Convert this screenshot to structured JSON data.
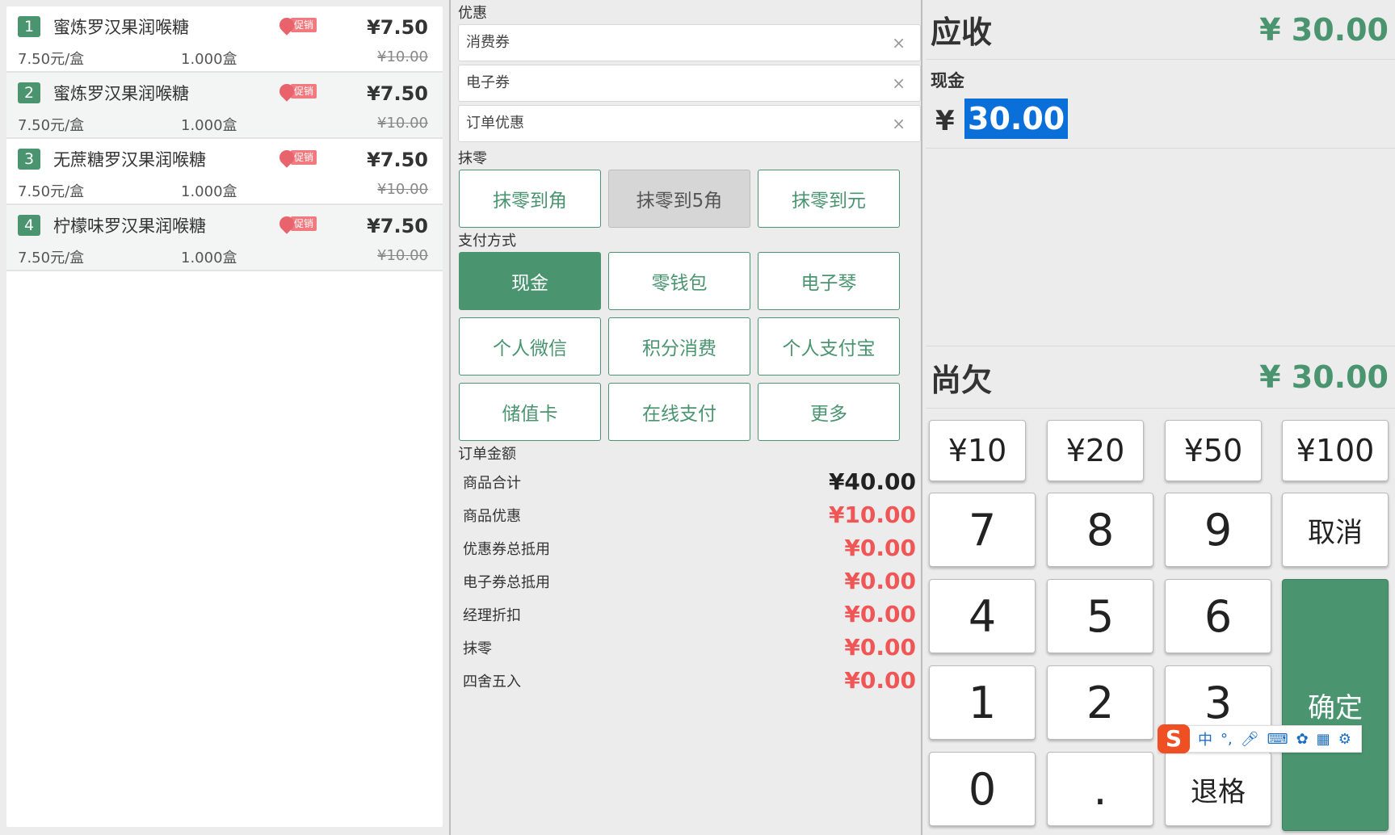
{
  "items": [
    {
      "no": "1",
      "name": "蜜炼罗汉果润喉糖",
      "promo": "促销",
      "price": "¥7.50",
      "unit_price": "7.50元/盒",
      "qty": "1.000盒",
      "orig_price": "¥10.00"
    },
    {
      "no": "2",
      "name": "蜜炼罗汉果润喉糖",
      "promo": "促销",
      "price": "¥7.50",
      "unit_price": "7.50元/盒",
      "qty": "1.000盒",
      "orig_price": "¥10.00"
    },
    {
      "no": "3",
      "name": "无蔗糖罗汉果润喉糖",
      "promo": "促销",
      "price": "¥7.50",
      "unit_price": "7.50元/盒",
      "qty": "1.000盒",
      "orig_price": "¥10.00"
    },
    {
      "no": "4",
      "name": "柠檬味罗汉果润喉糖",
      "promo": "促销",
      "price": "¥7.50",
      "unit_price": "7.50元/盒",
      "qty": "1.000盒",
      "orig_price": "¥10.00"
    }
  ],
  "discount": {
    "title": "优惠",
    "fields": [
      {
        "label": "消费券"
      },
      {
        "label": "电子券"
      },
      {
        "label": "订单优惠"
      }
    ],
    "clear_glyph": "×"
  },
  "rounding": {
    "title": "抹零",
    "options": [
      "抹零到角",
      "抹零到5角",
      "抹零到元"
    ],
    "selected_index": 1
  },
  "payment": {
    "title": "支付方式",
    "methods": [
      "现金",
      "零钱包",
      "电子琴",
      "个人微信",
      "积分消费",
      "个人支付宝",
      "储值卡",
      "在线支付",
      "更多"
    ],
    "active_index": 0
  },
  "order_amount": {
    "title": "订单金额",
    "rows": [
      {
        "label": "商品合计",
        "value": "¥40.00"
      },
      {
        "label": "商品优惠",
        "value": "¥10.00"
      },
      {
        "label": "优惠券总抵用",
        "value": "¥0.00"
      },
      {
        "label": "电子券总抵用",
        "value": "¥0.00"
      },
      {
        "label": "经理折扣",
        "value": "¥0.00"
      },
      {
        "label": "抹零",
        "value": "¥0.00"
      },
      {
        "label": "四舍五入",
        "value": "¥0.00"
      }
    ]
  },
  "receivable": {
    "label": "应收",
    "amount": "¥ 30.00"
  },
  "cash": {
    "label": "现金",
    "currency": "¥",
    "value": "30.00"
  },
  "owed": {
    "label": "尚欠",
    "amount": "¥ 30.00"
  },
  "keypad": {
    "quick": [
      "¥10",
      "¥20",
      "¥50",
      "¥100"
    ],
    "digits": [
      "7",
      "8",
      "9",
      "4",
      "5",
      "6",
      "1",
      "2",
      "3",
      "0",
      "."
    ],
    "cancel": "取消",
    "confirm": "确定",
    "backspace": "退格"
  },
  "ime": {
    "logo": "S",
    "mode": "中",
    "punct": "°,"
  },
  "colors": {
    "accent": "#4a9470",
    "negative": "#f05656",
    "selection": "#0a6fd8"
  }
}
